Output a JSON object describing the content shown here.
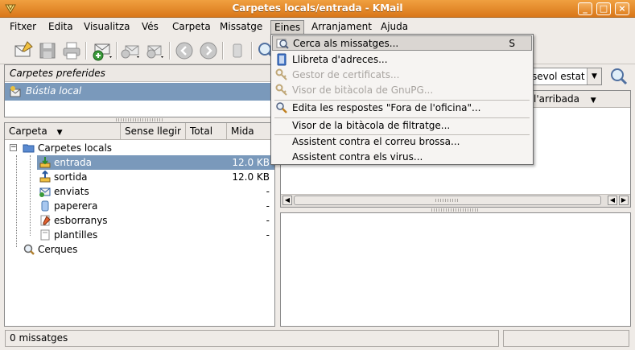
{
  "window": {
    "title": "Carpetes locals/entrada - KMail"
  },
  "menubar": [
    {
      "label": "Fitxer"
    },
    {
      "label": "Edita"
    },
    {
      "label": "Visualitza"
    },
    {
      "label": "Vés"
    },
    {
      "label": "Carpeta"
    },
    {
      "label": "Missatge"
    },
    {
      "label": "Eines"
    },
    {
      "label": "Arranjament"
    },
    {
      "label": "Ajuda"
    }
  ],
  "favorites": {
    "header": "Carpetes preferides",
    "items": [
      {
        "label": "Bústia local"
      }
    ]
  },
  "folders": {
    "columns": {
      "name": "Carpeta",
      "unread": "Sense llegir",
      "total": "Total",
      "size": "Mida"
    },
    "root": "Carpetes locals",
    "items": [
      {
        "name": "entrada",
        "size": "12.0 KB",
        "selected": true
      },
      {
        "name": "sortida",
        "size": "12.0 KB"
      },
      {
        "name": "enviats",
        "size": "-"
      },
      {
        "name": "paperera",
        "size": "-"
      },
      {
        "name": "esborranys",
        "size": "-"
      },
      {
        "name": "plantilles",
        "size": "-"
      }
    ],
    "searches": "Cerques"
  },
  "search": {
    "status_filter": "sevol estat"
  },
  "message_list": {
    "sort_column": "l'arribada"
  },
  "status": {
    "message_count": "0 missatges"
  },
  "tools_menu": {
    "items": [
      {
        "label": "Cerca als missatges...",
        "shortcut": "S",
        "enabled": true,
        "highlighted": true
      },
      {
        "label": "Llibreta d'adreces...",
        "enabled": true
      },
      {
        "label": "Gestor de certificats...",
        "enabled": false
      },
      {
        "label": "Visor de bitàcola de GnuPG...",
        "enabled": false
      },
      {
        "label": "Edita les respostes \"Fora de l'oficina\"...",
        "enabled": true
      },
      {
        "label": "Visor de la bitàcola de filtratge...",
        "enabled": true
      },
      {
        "label": "Assistent contra el correu brossa...",
        "enabled": true
      },
      {
        "label": "Assistent contra els virus...",
        "enabled": true
      }
    ]
  },
  "colors": {
    "titlebar": "#e38a2a",
    "selection": "#7a99bb",
    "window_bg": "#efebe7"
  }
}
